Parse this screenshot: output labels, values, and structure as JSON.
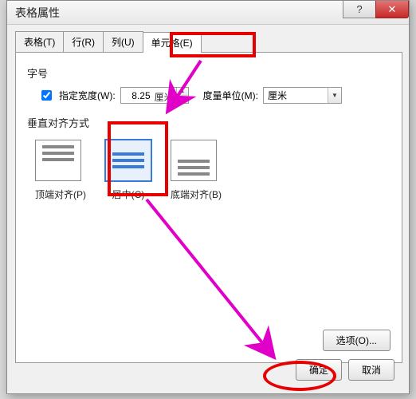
{
  "titlebar": {
    "title": "表格属性"
  },
  "tabs": {
    "table": "表格(T)",
    "row": "行(R)",
    "column": "列(U)",
    "cell": "单元格(E)"
  },
  "size": {
    "section": "字号",
    "specify_width_label": "指定宽度(W):",
    "width_value": "8.25",
    "width_unit": "厘米",
    "measure_unit_label": "度量单位(M):",
    "measure_unit_value": "厘米"
  },
  "valign": {
    "section": "垂直对齐方式",
    "top": "顶端对齐(P)",
    "center": "居中(C)",
    "bottom": "底端对齐(B)"
  },
  "buttons": {
    "options": "选项(O)...",
    "ok": "确定",
    "cancel": "取消"
  }
}
